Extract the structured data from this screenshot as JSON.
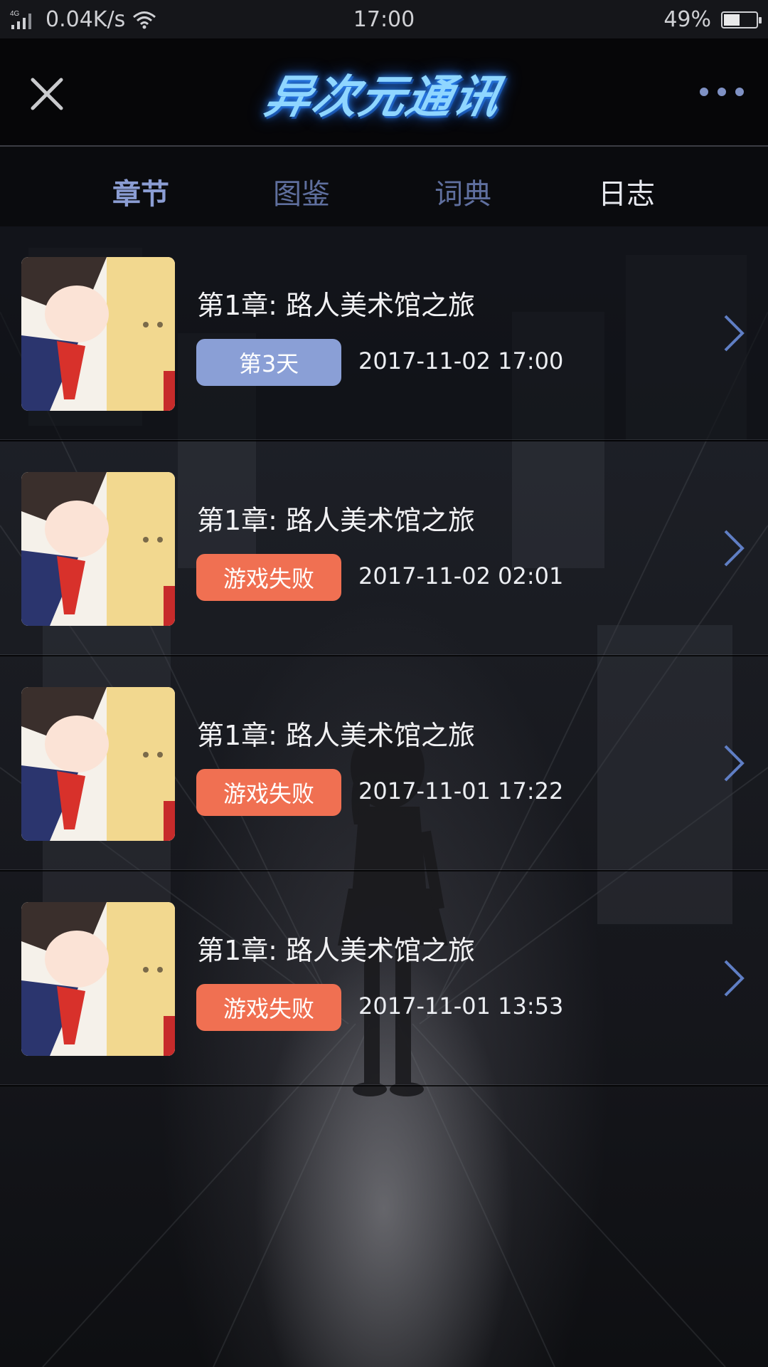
{
  "status_bar": {
    "network": "4G",
    "speed": "0.04K/s",
    "time": "17:00",
    "battery_percent": "49%",
    "battery_level": 0.49
  },
  "header": {
    "logo_text": "异次元通讯",
    "close_icon": "close-icon",
    "more_icon": "more-dots-icon"
  },
  "tabs": [
    {
      "label": "章节"
    },
    {
      "label": "图鉴"
    },
    {
      "label": "词典"
    },
    {
      "label": "日志"
    }
  ],
  "entries": [
    {
      "title": "第1章: 路人美术馆之旅",
      "badge": "第3天",
      "badge_type": "day",
      "datetime": "2017-11-02 17:00"
    },
    {
      "title": "第1章: 路人美术馆之旅",
      "badge": "游戏失败",
      "badge_type": "fail",
      "datetime": "2017-11-02 02:01"
    },
    {
      "title": "第1章: 路人美术馆之旅",
      "badge": "游戏失败",
      "badge_type": "fail",
      "datetime": "2017-11-01 17:22"
    },
    {
      "title": "第1章: 路人美术馆之旅",
      "badge": "游戏失败",
      "badge_type": "fail",
      "datetime": "2017-11-01 13:53"
    }
  ],
  "colors": {
    "day_badge": "#8a9fd6",
    "fail_badge": "#f07052",
    "tab_active": "#8b9dd3",
    "tab_selected": "#e6e8ee"
  }
}
